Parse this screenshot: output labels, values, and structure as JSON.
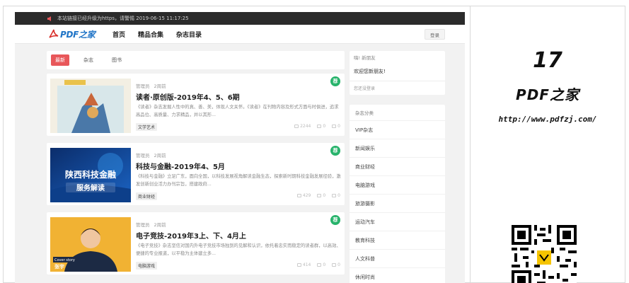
{
  "notice": {
    "text": "本站链接已经升级为https，请警惕   2019-06-15 11:17:25"
  },
  "nav": {
    "logo_text": "PDF之家",
    "links": [
      "首页",
      "精品合集",
      "杂志目录"
    ],
    "login_label": "登录"
  },
  "tabs": [
    "最新",
    "杂志",
    "图书"
  ],
  "posts": [
    {
      "author": "管理员",
      "time": "2周前",
      "title": "读者·原创版-2019年4、5、6期",
      "desc": "《读者》杂志发掘人性中的真、善、美，体现人文关怀。《读者》在刊物内容及形式方面与时俱进，追求高品位、高质量、力求精品，并以其形...",
      "tag": "文学艺术",
      "views": "2244",
      "comments": "0",
      "likes": "0",
      "badge": "荐"
    },
    {
      "author": "管理员",
      "time": "2周前",
      "title": "科技与金融-2019年4、5月",
      "desc": "《科技与金融》立足广东，面向全国，以科技发展视角解读金融生态，探索新时期科技金融发展径验，激发创新创业活力办刊宗旨，搭建政府...",
      "tag": "商业财经",
      "views": "429",
      "comments": "0",
      "likes": "0",
      "badge": "荐",
      "thumb_text_1": "陕西科技金融",
      "thumb_text_2": "服务解读"
    },
    {
      "author": "管理员",
      "time": "2周前",
      "title": "电子竞技-2019年3上、下、4月上",
      "desc": "《电子竞技》杂志坚信对国内外电子竞技市场独到的见解和认识，依托着忠实而稳定的读者群，以高效、便捷的专业报道，以平稳为主体建立多...",
      "tag": "电脑游戏",
      "views": "414",
      "comments": "0",
      "likes": "0",
      "badge": "荐",
      "thumb_text_1": "Cover story",
      "thumb_text_2": "张宇"
    }
  ],
  "sidebar": {
    "greeting_head": "嗨! 新朋友",
    "welcome": "欢迎您新朋友!",
    "login_note": "您还没登录",
    "category_title": "杂志分类",
    "categories": [
      "VIP杂志",
      "新闻娱乐",
      "商业财经",
      "电脑游戏",
      "旅游摄影",
      "运动汽车",
      "教育科技",
      "人文科普",
      "休闲时尚"
    ]
  },
  "brand": {
    "number": "17",
    "name": "PDF之家",
    "url": "http://www.pdfzj.com/"
  }
}
